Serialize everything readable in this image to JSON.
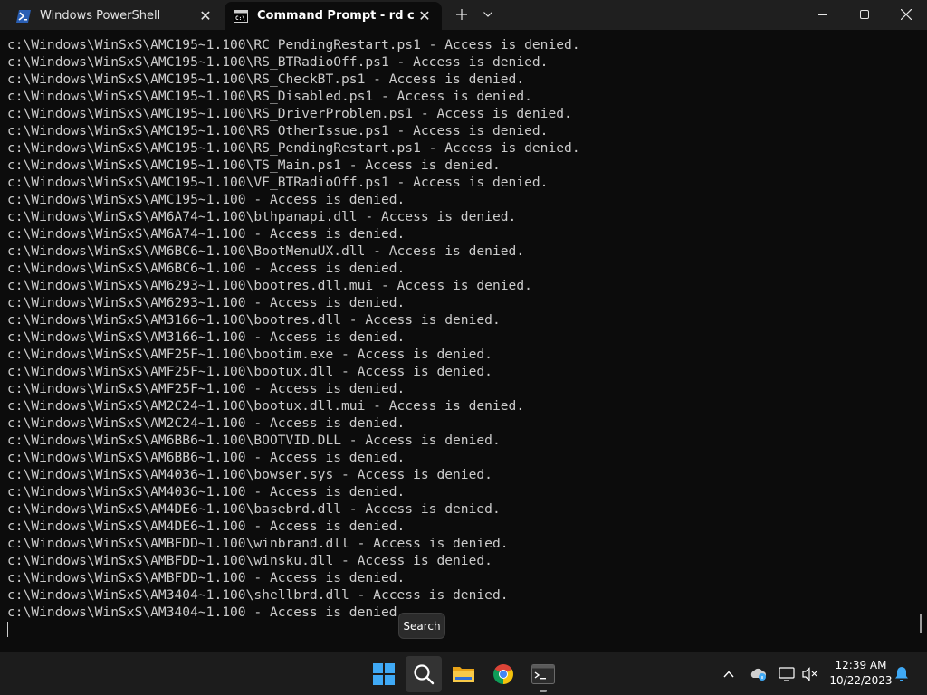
{
  "tabs": [
    {
      "label": "Windows PowerShell",
      "active": false,
      "icon": "powershell-icon"
    },
    {
      "label": "Command Prompt - rd  c:\\ /s ",
      "active": true,
      "icon": "cmd-icon"
    }
  ],
  "titlebar": {
    "new_tab_icon": "plus-icon",
    "dropdown_icon": "chevron-down-icon"
  },
  "console": {
    "lines": [
      "c:\\Windows\\WinSxS\\AMC195~1.100\\RC_PendingRestart.ps1 - Access is denied.",
      "c:\\Windows\\WinSxS\\AMC195~1.100\\RS_BTRadioOff.ps1 - Access is denied.",
      "c:\\Windows\\WinSxS\\AMC195~1.100\\RS_CheckBT.ps1 - Access is denied.",
      "c:\\Windows\\WinSxS\\AMC195~1.100\\RS_Disabled.ps1 - Access is denied.",
      "c:\\Windows\\WinSxS\\AMC195~1.100\\RS_DriverProblem.ps1 - Access is denied.",
      "c:\\Windows\\WinSxS\\AMC195~1.100\\RS_OtherIssue.ps1 - Access is denied.",
      "c:\\Windows\\WinSxS\\AMC195~1.100\\RS_PendingRestart.ps1 - Access is denied.",
      "c:\\Windows\\WinSxS\\AMC195~1.100\\TS_Main.ps1 - Access is denied.",
      "c:\\Windows\\WinSxS\\AMC195~1.100\\VF_BTRadioOff.ps1 - Access is denied.",
      "c:\\Windows\\WinSxS\\AMC195~1.100 - Access is denied.",
      "c:\\Windows\\WinSxS\\AM6A74~1.100\\bthpanapi.dll - Access is denied.",
      "c:\\Windows\\WinSxS\\AM6A74~1.100 - Access is denied.",
      "c:\\Windows\\WinSxS\\AM6BC6~1.100\\BootMenuUX.dll - Access is denied.",
      "c:\\Windows\\WinSxS\\AM6BC6~1.100 - Access is denied.",
      "c:\\Windows\\WinSxS\\AM6293~1.100\\bootres.dll.mui - Access is denied.",
      "c:\\Windows\\WinSxS\\AM6293~1.100 - Access is denied.",
      "c:\\Windows\\WinSxS\\AM3166~1.100\\bootres.dll - Access is denied.",
      "c:\\Windows\\WinSxS\\AM3166~1.100 - Access is denied.",
      "c:\\Windows\\WinSxS\\AMF25F~1.100\\bootim.exe - Access is denied.",
      "c:\\Windows\\WinSxS\\AMF25F~1.100\\bootux.dll - Access is denied.",
      "c:\\Windows\\WinSxS\\AMF25F~1.100 - Access is denied.",
      "c:\\Windows\\WinSxS\\AM2C24~1.100\\bootux.dll.mui - Access is denied.",
      "c:\\Windows\\WinSxS\\AM2C24~1.100 - Access is denied.",
      "c:\\Windows\\WinSxS\\AM6BB6~1.100\\BOOTVID.DLL - Access is denied.",
      "c:\\Windows\\WinSxS\\AM6BB6~1.100 - Access is denied.",
      "c:\\Windows\\WinSxS\\AM4036~1.100\\bowser.sys - Access is denied.",
      "c:\\Windows\\WinSxS\\AM4036~1.100 - Access is denied.",
      "c:\\Windows\\WinSxS\\AM4DE6~1.100\\basebrd.dll - Access is denied.",
      "c:\\Windows\\WinSxS\\AM4DE6~1.100 - Access is denied.",
      "c:\\Windows\\WinSxS\\AMBFDD~1.100\\winbrand.dll - Access is denied.",
      "c:\\Windows\\WinSxS\\AMBFDD~1.100\\winsku.dll - Access is denied.",
      "c:\\Windows\\WinSxS\\AMBFDD~1.100 - Access is denied.",
      "c:\\Windows\\WinSxS\\AM3404~1.100\\shellbrd.dll - Access is denied.",
      "c:\\Windows\\WinSxS\\AM3404~1.100 - Access is denied."
    ]
  },
  "tooltip": {
    "text": "Search"
  },
  "taskbar": {
    "apps": [
      {
        "name": "start-icon"
      },
      {
        "name": "search-icon"
      },
      {
        "name": "file-explorer-icon"
      },
      {
        "name": "chrome-icon"
      },
      {
        "name": "terminal-icon"
      }
    ],
    "tray": {
      "icons": [
        "chevron-up-icon",
        "cloud-info-icon",
        "screen-icon",
        "volume-muted-icon",
        "notification-bell-icon"
      ],
      "time": "12:39 AM",
      "date": "10/22/2023"
    }
  },
  "colors": {
    "terminal_bg": "#0c0c0c",
    "terminal_text": "#cccccc",
    "titlebar_bg": "#1f1f1f",
    "taskbar_bg": "#1c1c1c"
  }
}
